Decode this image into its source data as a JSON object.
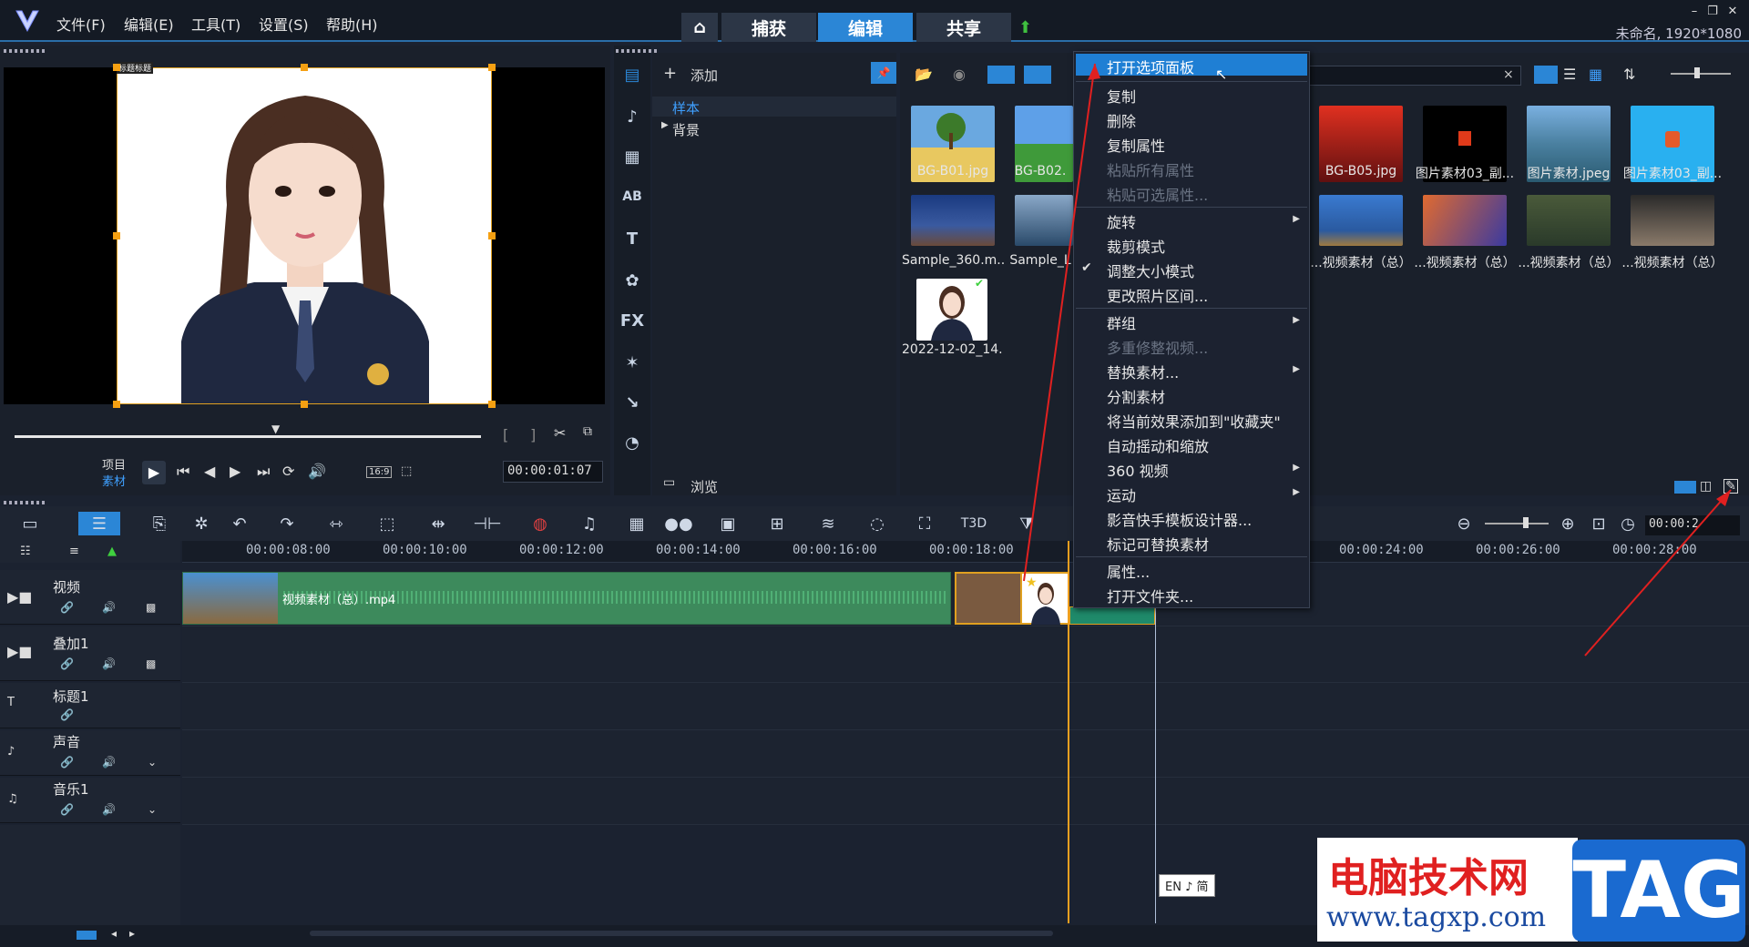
{
  "menu": {
    "file": "文件(F)",
    "edit": "编辑(E)",
    "tools": "工具(T)",
    "settings": "设置(S)",
    "help": "帮助(H)"
  },
  "tabs": {
    "capture": "捕获",
    "edit": "编辑",
    "share": "共享"
  },
  "title_info": "未命名, 1920*1080",
  "preview": {
    "photo_label": "标题标题",
    "project_label": "项目",
    "clip_label": "素材",
    "timecode": "00:00:01:07",
    "aspect": "16:9"
  },
  "library": {
    "add_label": "添加",
    "folders": [
      "样本",
      "背景"
    ],
    "browse_label": "浏览",
    "search_close": "×"
  },
  "thumbnails": [
    {
      "caption": "BG-B01.jpg"
    },
    {
      "caption": "BG-B02."
    },
    {
      "caption": "Sample_360.m..."
    },
    {
      "caption": "Sample_L"
    },
    {
      "caption": "2022-12-02_14..."
    },
    {
      "caption": "BG-B05.jpg"
    },
    {
      "caption": "图片素材03_副..."
    },
    {
      "caption": "图片素材.jpeg"
    },
    {
      "caption": "图片素材03_副..."
    },
    {
      "caption": "...视频素材（总）"
    },
    {
      "caption": "...视频素材（总）"
    },
    {
      "caption": "...视频素材（总）"
    },
    {
      "caption": "...视频素材（总）"
    }
  ],
  "context_menu": {
    "items": [
      {
        "label": "打开选项面板",
        "state": "highlighted"
      },
      {
        "label": "复制"
      },
      {
        "label": "删除"
      },
      {
        "label": "复制属性"
      },
      {
        "label": "粘贴所有属性",
        "state": "disabled"
      },
      {
        "label": "粘贴可选属性...",
        "state": "disabled"
      },
      {
        "label": "旋转",
        "submenu": true
      },
      {
        "label": "裁剪模式"
      },
      {
        "label": "调整大小模式",
        "checked": true
      },
      {
        "label": "更改照片区间..."
      },
      {
        "label": "群组",
        "submenu": true
      },
      {
        "label": "多重修整视频...",
        "state": "disabled"
      },
      {
        "label": "替换素材...",
        "submenu": true
      },
      {
        "label": "分割素材"
      },
      {
        "label": "将当前效果添加到\"收藏夹\""
      },
      {
        "label": "自动摇动和缩放"
      },
      {
        "label": "360 视频",
        "submenu": true
      },
      {
        "label": "运动",
        "submenu": true
      },
      {
        "label": "影音快手模板设计器..."
      },
      {
        "label": "标记可替换素材"
      },
      {
        "label": "属性..."
      },
      {
        "label": "打开文件夹..."
      }
    ]
  },
  "timeline": {
    "ruler": [
      "00:00:08:00",
      "00:00:10:00",
      "00:00:12:00",
      "00:00:14:00",
      "00:00:16:00",
      "00:00:18:00",
      "00:00:24:00",
      "00:00:26:00",
      "00:00:28:00"
    ],
    "timecode": "00:00:2",
    "tracks": [
      "视频",
      "叠加1",
      "标题1",
      "声音",
      "音乐1"
    ],
    "video_clip_label": "视频素材（总）.mp4"
  },
  "ime": "EN ♪ 简",
  "watermark": {
    "title": "电脑技术网",
    "url": "www.tagxp.com",
    "tag": "TAG"
  },
  "colors": {
    "accent": "#2b86d6",
    "highlight": "#1f7fd4",
    "clip_green": "#3d8a5c",
    "playhead": "#f0a020"
  }
}
